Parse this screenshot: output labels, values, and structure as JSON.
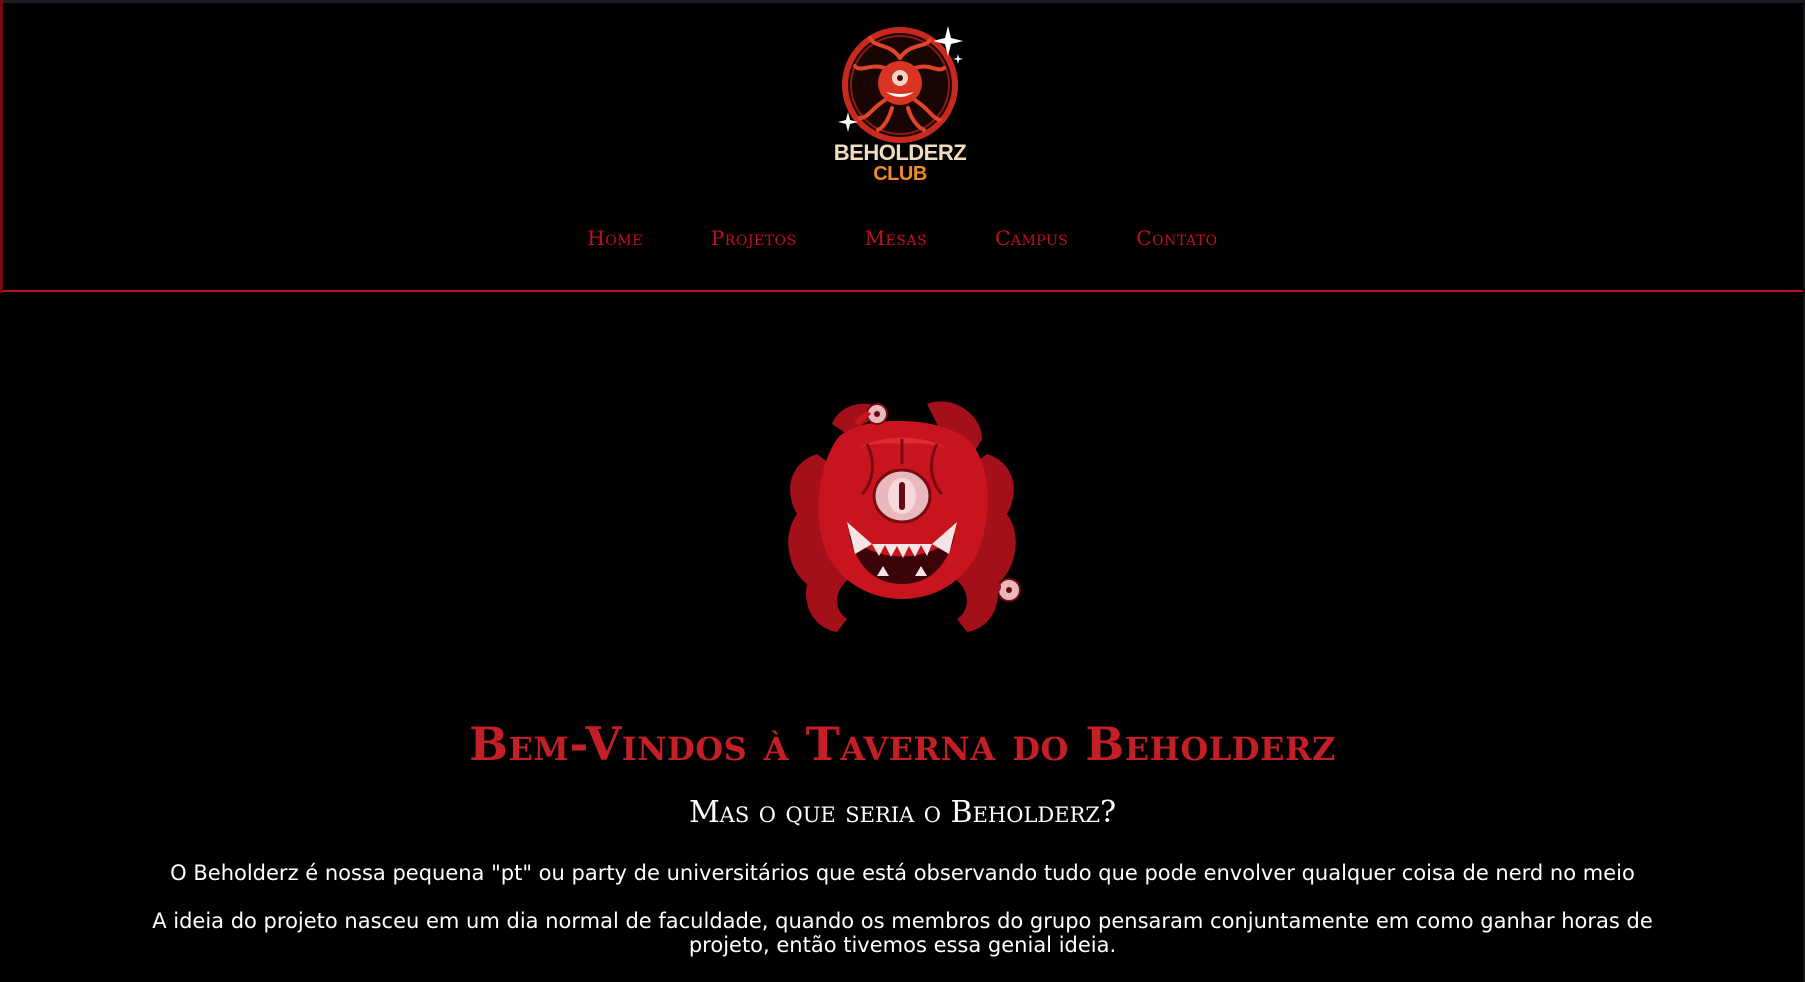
{
  "header": {
    "logo": {
      "name": "BEHOLDERZ",
      "sub": "CLUB"
    },
    "nav": [
      {
        "label": "Home"
      },
      {
        "label": "Projetos"
      },
      {
        "label": "Mesas"
      },
      {
        "label": "Campus"
      },
      {
        "label": "Contato"
      }
    ]
  },
  "main": {
    "title": "Bem-Vindos à Taverna do Beholderz",
    "subtitle": "Mas o que seria o Beholderz?",
    "paragraphs": [
      "O Beholderz é nossa pequena \"pt\" ou party de universitários que está observando tudo que pode envolver qualquer coisa de nerd no meio",
      "A ideia do projeto nasceu em um dia normal de faculdade, quando os membros do grupo pensaram conjuntamente em como ganhar horas de projeto, então tivemos essa genial ideia."
    ]
  },
  "colors": {
    "background": "#000000",
    "accent": "#c41e26",
    "nav_link": "#c40f1b",
    "logo_orange": "#f08a24"
  },
  "icons": {
    "logo": "beholder-logo-icon",
    "hero": "beholder-monster-icon"
  }
}
